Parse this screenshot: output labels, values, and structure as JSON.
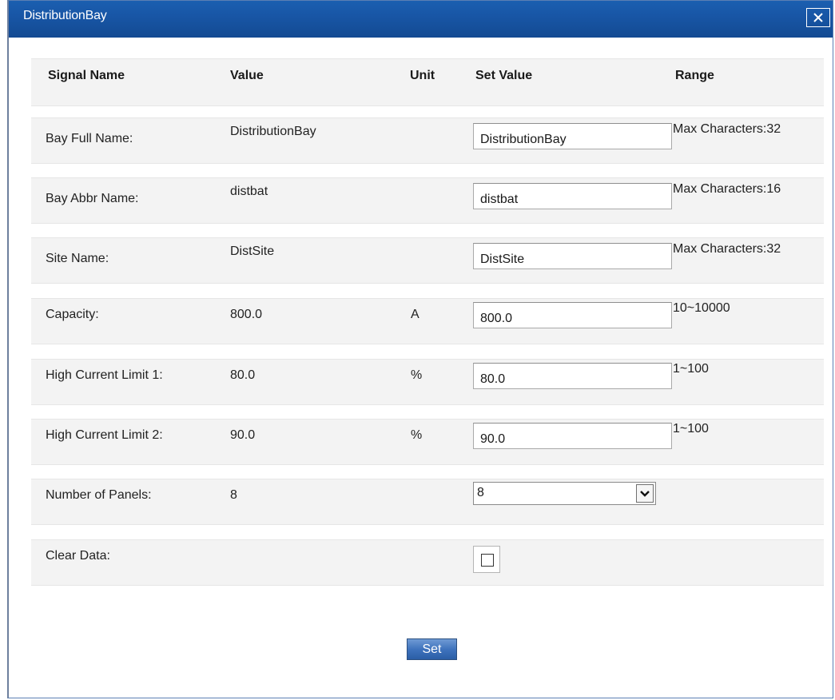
{
  "window": {
    "title": "DistributionBay",
    "close_icon": "close-icon"
  },
  "table": {
    "headers": {
      "signal_name": "Signal Name",
      "value": "Value",
      "unit": "Unit",
      "set_value": "Set Value",
      "range": "Range"
    },
    "rows": [
      {
        "name": "Bay Full Name:",
        "value": "DistributionBay",
        "unit": "",
        "set_value": "DistributionBay",
        "range": "Max Characters:32",
        "control": "text"
      },
      {
        "name": "Bay Abbr Name:",
        "value": "distbat",
        "unit": "",
        "set_value": "distbat",
        "range": "Max Characters:16",
        "control": "text"
      },
      {
        "name": "Site Name:",
        "value": "DistSite",
        "unit": "",
        "set_value": "DistSite",
        "range": "Max Characters:32",
        "control": "text"
      },
      {
        "name": "Capacity:",
        "value": "800.0",
        "unit": "A",
        "set_value": "800.0",
        "range": "10~10000",
        "control": "text"
      },
      {
        "name": "High Current Limit 1:",
        "value": "80.0",
        "unit": "%",
        "set_value": "80.0",
        "range": "1~100",
        "control": "text"
      },
      {
        "name": "High Current Limit 2:",
        "value": "90.0",
        "unit": "%",
        "set_value": "90.0",
        "range": "1~100",
        "control": "text"
      },
      {
        "name": "Number of Panels:",
        "value": "8",
        "unit": "",
        "set_value": "8",
        "range": "",
        "control": "select"
      },
      {
        "name": "Clear Data:",
        "value": "",
        "unit": "",
        "set_value": "",
        "range": "",
        "control": "checkbox",
        "checked": false
      }
    ]
  },
  "actions": {
    "set_label": "Set"
  },
  "colors": {
    "titlebar": "#1856a6",
    "row_background": "#f3f3f3",
    "button": "#3f73bd"
  }
}
